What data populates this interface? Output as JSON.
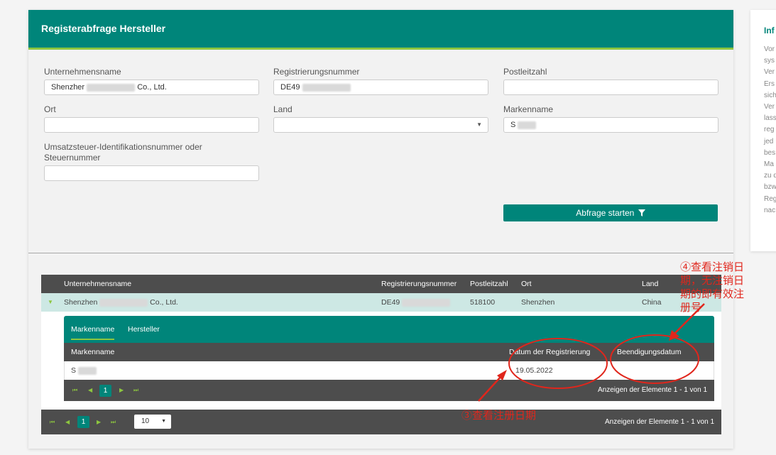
{
  "header": {
    "title": "Registerabfrage Hersteller"
  },
  "form": {
    "company_label": "Unternehmensname",
    "company_value": "Shenzhen Co., Ltd.",
    "company_value_start": "Shenzher",
    "company_value_end": "Co., Ltd.",
    "regnum_label": "Registrierungsnummer",
    "regnum_value": "DE49",
    "zip_label": "Postleitzahl",
    "zip_value": "",
    "city_label": "Ort",
    "city_value": "",
    "country_label": "Land",
    "country_value": "",
    "brand_label": "Markenname",
    "brand_value": "S",
    "vat_label_line1": "Umsatzsteuer-Identifikationsnummer oder",
    "vat_label_line2": "Steuernummer",
    "vat_value": "",
    "submit_label": "Abfrage starten"
  },
  "results": {
    "columns": [
      "Unternehmensname",
      "Registrierungsnummer",
      "Postleitzahl",
      "Ort",
      "Land"
    ],
    "row": {
      "company": "Shenzhen Co., Ltd.",
      "company_start": "Shenzhen",
      "company_end": "Co., Ltd.",
      "regnum": "DE49",
      "zip": "518100",
      "city": "Shenzhen",
      "country": "China"
    },
    "detail": {
      "tabs": [
        "Markenname",
        "Hersteller"
      ],
      "columns": [
        "Markenname",
        "Datum der Registrierung",
        "Beendigungsdatum"
      ],
      "row": {
        "brand": "S",
        "reg_date": "19.05.2022",
        "end_date": ""
      },
      "pager": {
        "current_page": "1",
        "info": "Anzeigen der Elemente 1 - 1 von 1"
      }
    },
    "pager": {
      "current_page": "1",
      "page_size": "10",
      "info": "Anzeigen der Elemente 1 - 1 von 1"
    }
  },
  "side": {
    "title": "Inf",
    "lines": [
      "Vor",
      "sys",
      "Ver",
      "Ers",
      "sich",
      "Ver",
      "lass",
      "reg",
      "jed",
      "bes",
      "Ma",
      "zu d",
      "bzw",
      "Reg",
      "nac"
    ]
  },
  "annotations": {
    "note4_lines": [
      "④查看注销日",
      "期，无注销日",
      "期的即有效注",
      "册号"
    ],
    "note3": "③查看注册日期",
    "color": "#e0261c"
  },
  "colors": {
    "primary": "#00857a",
    "accent": "#8dc63f",
    "dark": "#4d4d4d"
  }
}
